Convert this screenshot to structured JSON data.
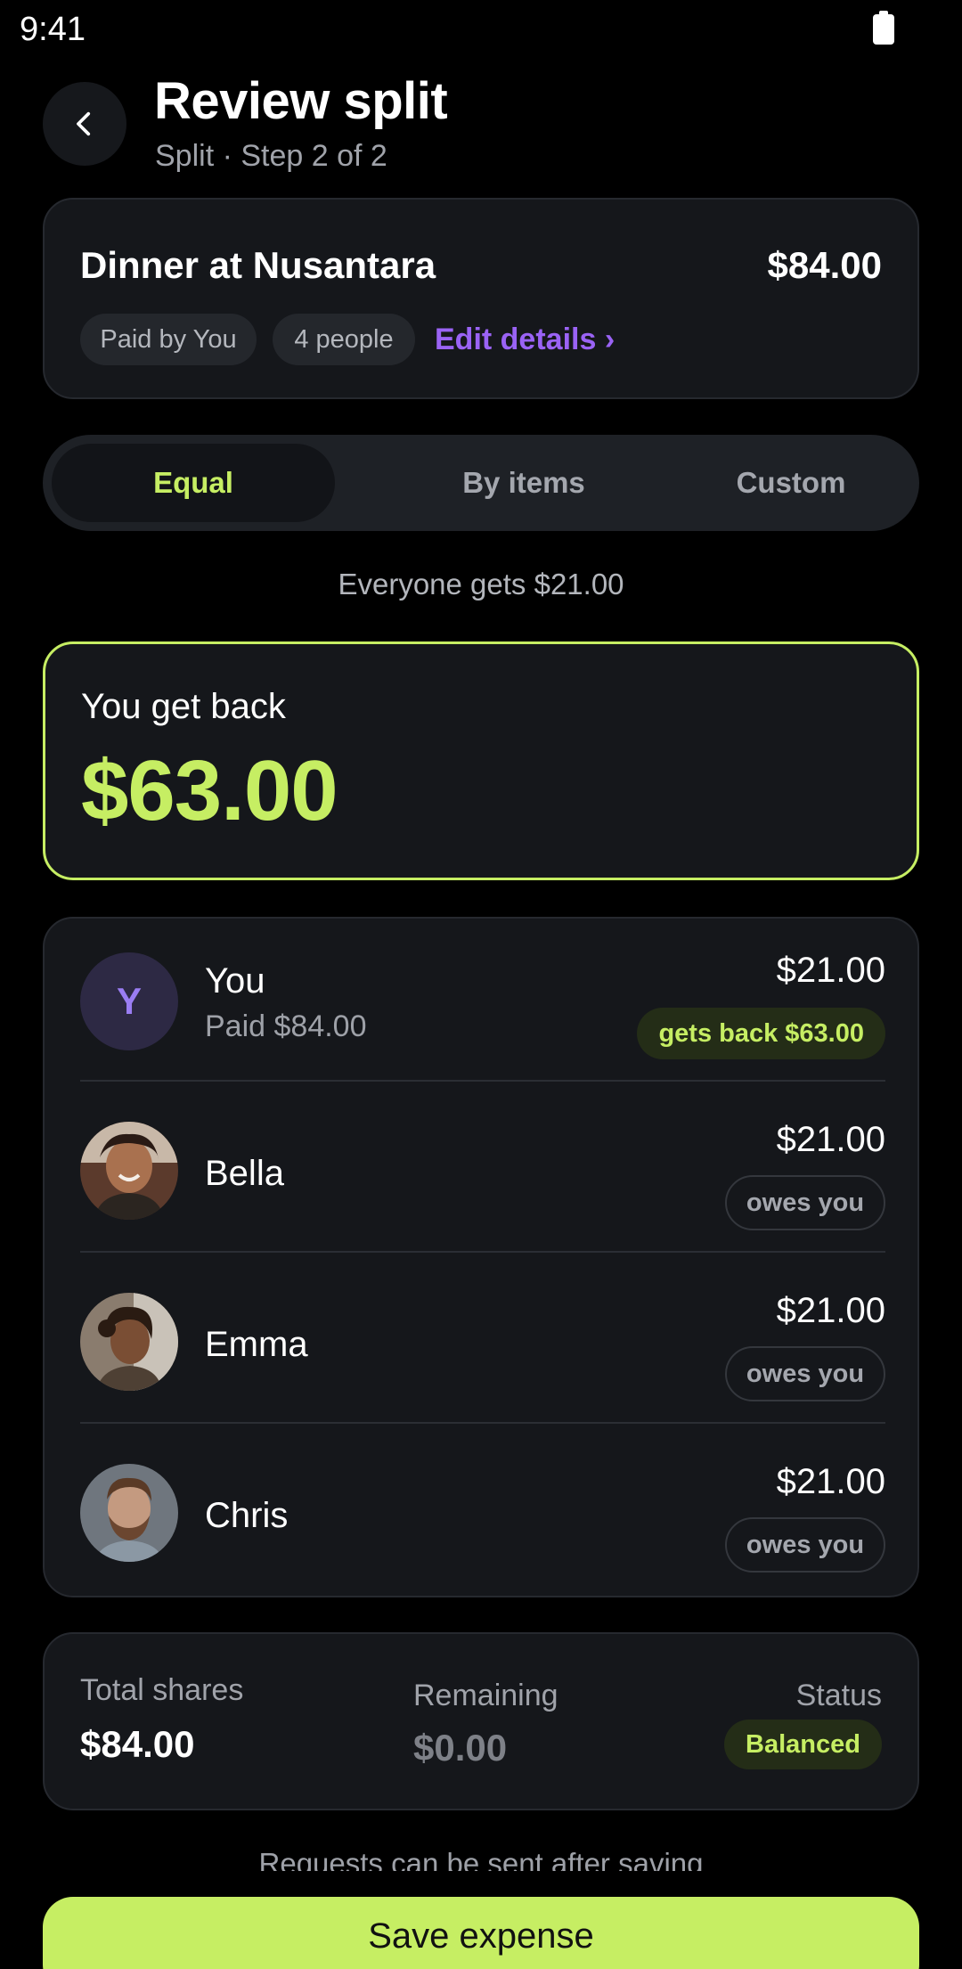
{
  "status_bar": {
    "time": "9:41"
  },
  "header": {
    "title": "Review split",
    "subtitle": "Split · Step 2 of 2"
  },
  "expense": {
    "title": "Dinner at Nusantara",
    "amount": "$84.00",
    "paid_by": "Paid by You",
    "people_count": "4 people",
    "edit_link": "Edit details ›"
  },
  "split_tabs": [
    {
      "label": "Equal",
      "selected": true
    },
    {
      "label": "By items",
      "selected": false
    },
    {
      "label": "Custom",
      "selected": false
    }
  ],
  "everyone_note": "Everyone gets $21.00",
  "summary_hero": {
    "label": "You get back",
    "amount": "$63.00"
  },
  "people": [
    {
      "initial": "Y",
      "name": "You",
      "sub": "Paid $84.00",
      "amount": "$21.00",
      "badge": "gets back $63.00",
      "badge_style": "positive"
    },
    {
      "name": "Bella",
      "amount": "$21.00",
      "badge": "owes you",
      "badge_style": "neutral"
    },
    {
      "name": "Emma",
      "amount": "$21.00",
      "badge": "owes you",
      "badge_style": "neutral"
    },
    {
      "name": "Chris",
      "amount": "$21.00",
      "badge": "owes you",
      "badge_style": "neutral"
    }
  ],
  "totals": {
    "total_label": "Total shares",
    "total_value": "$84.00",
    "remaining_label": "Remaining",
    "remaining_value": "$0.00",
    "status_label": "Status",
    "status_value": "Balanced"
  },
  "footnote": "Requests can be sent after saving",
  "save_button": "Save expense",
  "colors": {
    "accent": "#c6ee63",
    "link": "#9a63f5",
    "background": "#000000",
    "card": "#15171b"
  }
}
